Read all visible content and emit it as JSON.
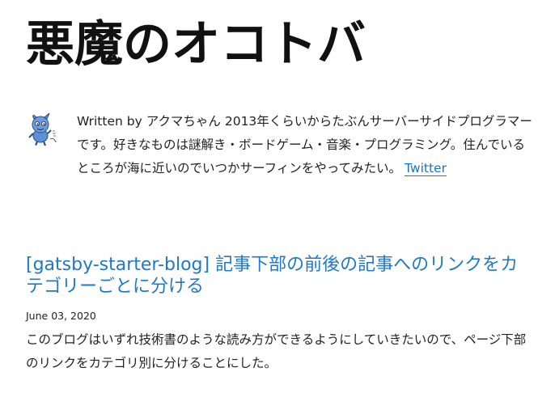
{
  "header": {
    "site_title": "悪魔のオコトバ"
  },
  "bio": {
    "avatar_icon": "devil-mascot-avatar-icon",
    "text": "Written by アクマちゃん 2013年くらいからたぶんサーバーサイドプログラマーです。好きなものは謎解き・ボードゲーム・音楽・プログラミング。住んでいるところが海に近いのでいつかサーフィンをやってみたい。",
    "twitter_label": "Twitter",
    "colors": {
      "link": "#1a73c8"
    }
  },
  "posts": [
    {
      "title": "[gatsby-starter-blog] 記事下部の前後の記事へのリンクをカテゴリーごとに分ける",
      "date": "June 03, 2020",
      "excerpt": "このブログはいずれ技術書のような読み方ができるようにしていきたいので、ページ下部のリンクをカテゴリ別に分けることにした。"
    }
  ]
}
